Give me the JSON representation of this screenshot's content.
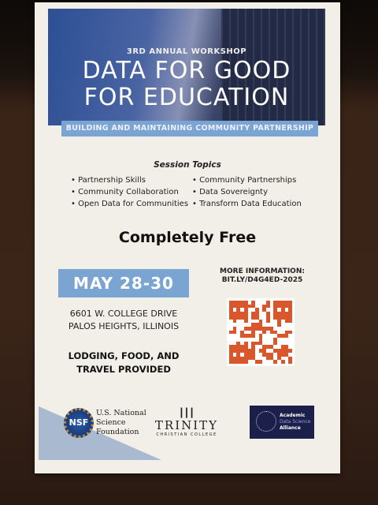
{
  "poster": {
    "kicker": "3RD ANNUAL WORKSHOP",
    "title_line1": "DATA FOR GOOD",
    "title_line2": "FOR EDUCATION",
    "subtitle": "BUILDING AND MAINTAINING COMMUNITY PARTNERSHIP",
    "topics_heading": "Session Topics",
    "topics_left": [
      "Partnership Skills",
      "Community Collaboration",
      "Open Data for Communities"
    ],
    "topics_right": [
      "Community Partnerships",
      "Data Sovereignty",
      "Transform Data Education"
    ],
    "price": "Completely Free",
    "dates": "MAY 28-30",
    "address_line1": "6601 W. COLLEGE DRIVE",
    "address_line2": "PALOS HEIGHTS, ILLINOIS",
    "perks_line1": "LODGING, FOOD, AND",
    "perks_line2": "TRAVEL PROVIDED",
    "more_info": "MORE INFORMATION:",
    "link": "BIT.LY/D4G4ED-2025",
    "sponsors": {
      "nsf_logo": "NSF",
      "nsf_line1": "U.S. National",
      "nsf_line2": "Science",
      "nsf_line3": "Foundation",
      "trinity_name": "TRINITY",
      "trinity_sub": "CHRISTIAN COLLEGE",
      "adsa_line1": "Academic",
      "adsa_line2": "Data Science",
      "adsa_line3": "Alliance"
    }
  }
}
